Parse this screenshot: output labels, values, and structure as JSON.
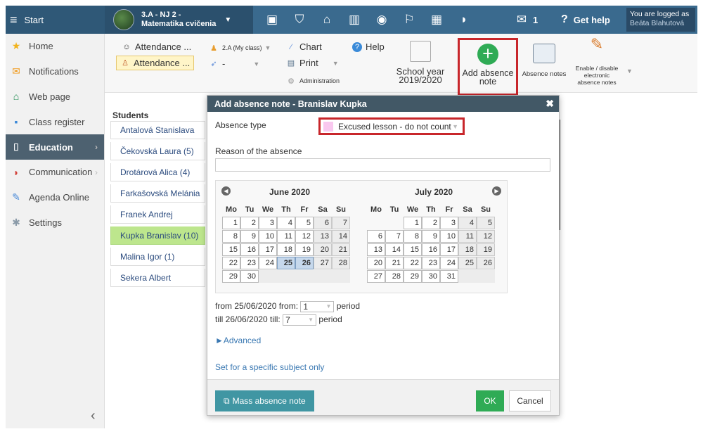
{
  "topbar": {
    "start_label": "Start",
    "class_line1": "3.A - NJ 2 -",
    "class_line2": "Matematika cvičenia",
    "mail_count": "1",
    "help_label": "Get help",
    "user_line1": "You are logged as",
    "user_name": "Beáta Blahutová",
    "icons": [
      "briefcase-icon",
      "shield-icon",
      "bank-icon",
      "chart-icon",
      "palette-icon",
      "walking-icon",
      "board-icon",
      "chat-icon",
      "mail-icon"
    ]
  },
  "sidebar": {
    "items": [
      {
        "label": "Home",
        "icon": "star-icon"
      },
      {
        "label": "Notifications",
        "icon": "envelope-icon"
      },
      {
        "label": "Web page",
        "icon": "house-icon"
      },
      {
        "label": "Class register",
        "icon": "book-icon"
      },
      {
        "label": "Education",
        "icon": "education-icon"
      },
      {
        "label": "Communication",
        "icon": "communication-icon"
      },
      {
        "label": "Agenda Online",
        "icon": "pen-icon"
      },
      {
        "label": "Settings",
        "icon": "gear-icon"
      }
    ]
  },
  "toolbar": {
    "attendance1": "Attendance ...",
    "attendance2": "Attendance ...",
    "class_select": "2.A (My class)",
    "dash": "-",
    "chart": "Chart",
    "print": "Print",
    "administration": "Administration",
    "help": "Help",
    "school_year_line1": "School year",
    "school_year_line2": "2019/2020",
    "add_absence_line1": "Add absence",
    "add_absence_line2": "note",
    "absence_notes": "Absence notes",
    "enable_line1": "Enable / disable",
    "enable_line2": "electronic",
    "enable_line3": "absence notes"
  },
  "students": {
    "title": "Students",
    "list": [
      "Antalová Stanislava",
      "Čekovská Laura (5)",
      "Drotárová Alica (4)",
      "Farkašovská Melánia",
      "Franek Andrej",
      "Kupka Branislav (10)",
      "Malina Igor (1)",
      "Sekera Albert"
    ],
    "active_index": 5
  },
  "modal": {
    "title": "Add absence note - Branislav Kupka",
    "absence_type_label": "Absence type",
    "absence_type_value": "Excused lesson - do not count",
    "reason_label": "Reason of the absence",
    "reason_value": "",
    "calendar": {
      "month1": "June 2020",
      "month2": "July 2020",
      "weekdays": [
        "Mo",
        "Tu",
        "We",
        "Th",
        "Fr",
        "Sa",
        "Su"
      ],
      "selected_days": [
        25,
        26
      ]
    },
    "from_text": "from 25/06/2020 from:",
    "from_value": "1",
    "till_text": "till 26/06/2020 till:",
    "till_value": "7",
    "period_label": "period",
    "advanced": "►Advanced",
    "specific_subject": "Set for a specific subject only",
    "mass_button": "Mass absence note",
    "ok_button": "OK",
    "cancel_button": "Cancel"
  }
}
